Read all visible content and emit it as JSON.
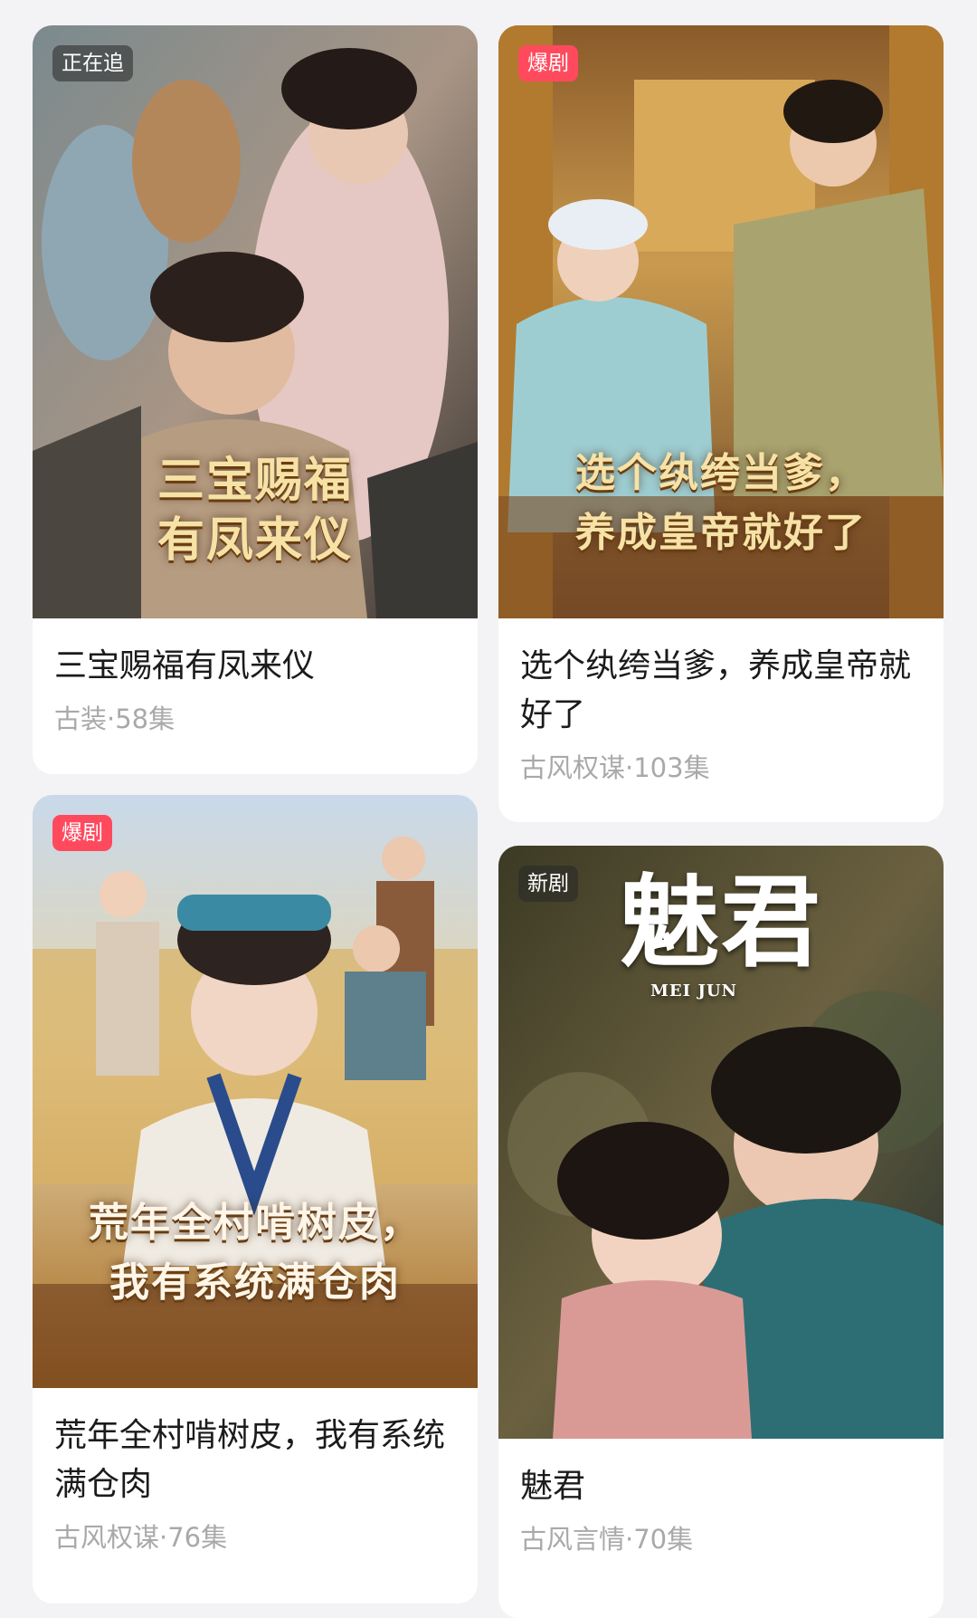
{
  "cards": [
    {
      "badge": "正在追",
      "poster_text": [
        "三宝赐福",
        "有凤来仪"
      ],
      "title": "三宝赐福有凤来仪",
      "meta": "古装·58集"
    },
    {
      "badge": "爆剧",
      "poster_text": [
        "选个纨绔当爹，",
        "养成皇帝就好了"
      ],
      "title": "选个纨绔当爹，养成皇帝就好了",
      "meta": "古风权谋·103集"
    },
    {
      "badge": "爆剧",
      "poster_text": [
        "荒年全村啃树皮，",
        "我有系统满仓肉"
      ],
      "title": "荒年全村啃树皮，我有系统满仓肉",
      "meta": "古风权谋·76集"
    },
    {
      "badge": "新剧",
      "poster_text": [
        "魅君",
        "MEI JUN"
      ],
      "title": "魅君",
      "meta": "古风言情·70集"
    }
  ],
  "colors": {
    "badge_hot": "#ff4a5e",
    "meta_text": "#a9a9a9",
    "title_text": "#1b1b1b"
  }
}
